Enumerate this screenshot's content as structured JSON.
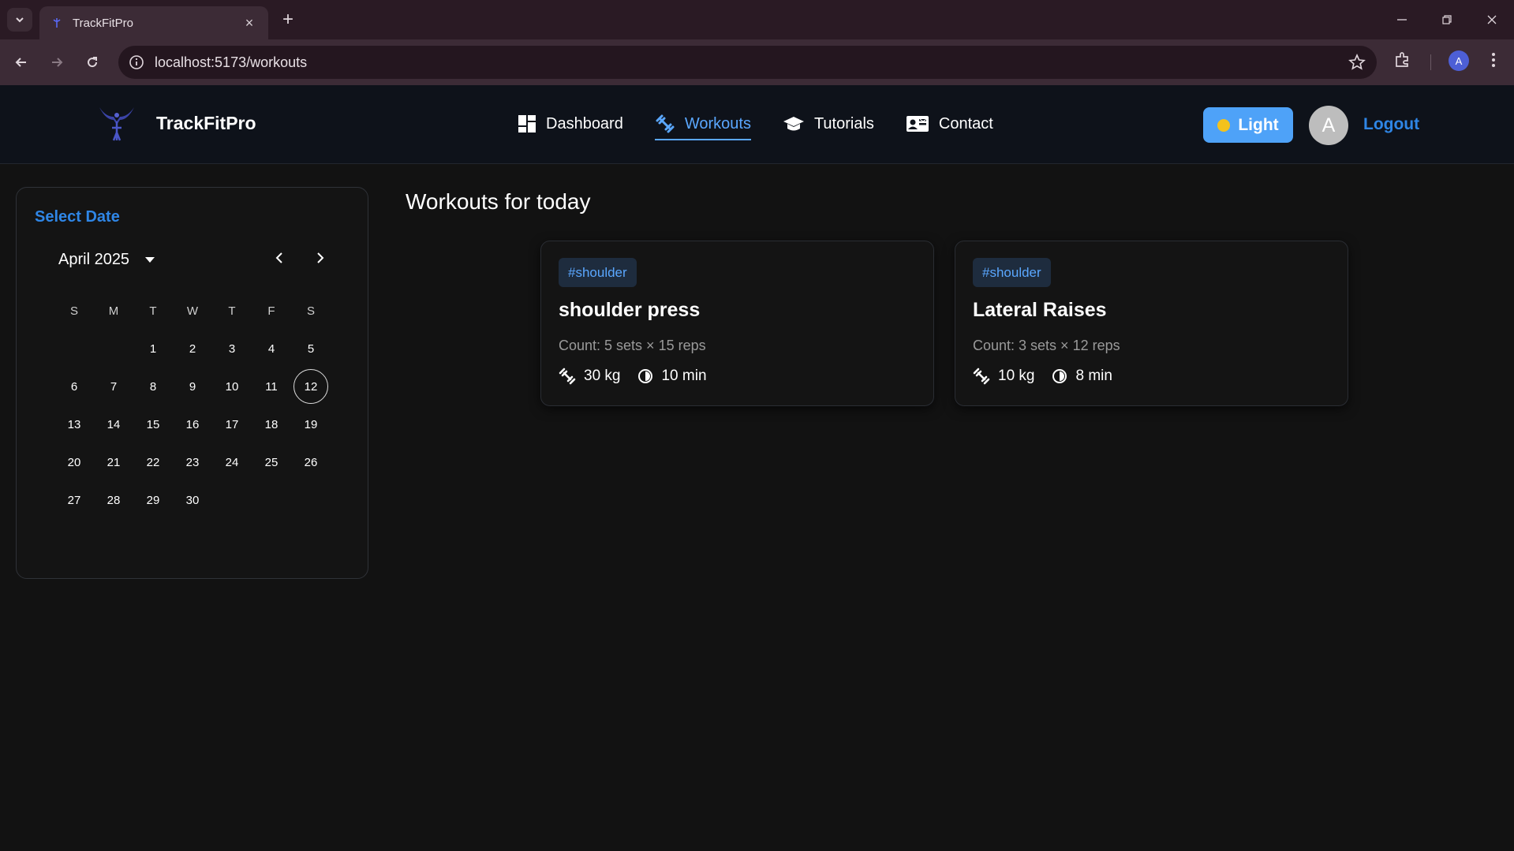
{
  "browser": {
    "tab_title": "TrackFitPro",
    "url": "localhost:5173/workouts",
    "profile_initial": "A"
  },
  "header": {
    "brand": "TrackFitPro",
    "nav": [
      {
        "label": "Dashboard",
        "icon": "dashboard-icon",
        "active": false
      },
      {
        "label": "Workouts",
        "icon": "dumbbell-icon",
        "active": true
      },
      {
        "label": "Tutorials",
        "icon": "graduation-cap-icon",
        "active": false
      },
      {
        "label": "Contact",
        "icon": "contact-card-icon",
        "active": false
      }
    ],
    "theme_label": "Light",
    "avatar_initial": "A",
    "logout_label": "Logout"
  },
  "calendar": {
    "title": "Select Date",
    "month_label": "April 2025",
    "weekdays": [
      "S",
      "M",
      "T",
      "W",
      "T",
      "F",
      "S"
    ],
    "weeks": [
      [
        "",
        "",
        "1",
        "2",
        "3",
        "4",
        "5"
      ],
      [
        "6",
        "7",
        "8",
        "9",
        "10",
        "11",
        "12"
      ],
      [
        "13",
        "14",
        "15",
        "16",
        "17",
        "18",
        "19"
      ],
      [
        "20",
        "21",
        "22",
        "23",
        "24",
        "25",
        "26"
      ],
      [
        "27",
        "28",
        "29",
        "30",
        "",
        "",
        ""
      ]
    ],
    "selected_day": "12"
  },
  "main": {
    "title": "Workouts for today",
    "workouts": [
      {
        "tag": "#shoulder",
        "name": "shoulder press",
        "count": "Count: 5 sets × 15 reps",
        "weight": "30 kg",
        "duration": "10 min"
      },
      {
        "tag": "#shoulder",
        "name": "Lateral Raises",
        "count": "Count: 3 sets × 12 reps",
        "weight": "10 kg",
        "duration": "8 min"
      }
    ]
  },
  "colors": {
    "accent": "#2f86e6",
    "active_nav": "#5aa7ff",
    "theme_button": "#4ea2f8",
    "background": "#121212"
  }
}
